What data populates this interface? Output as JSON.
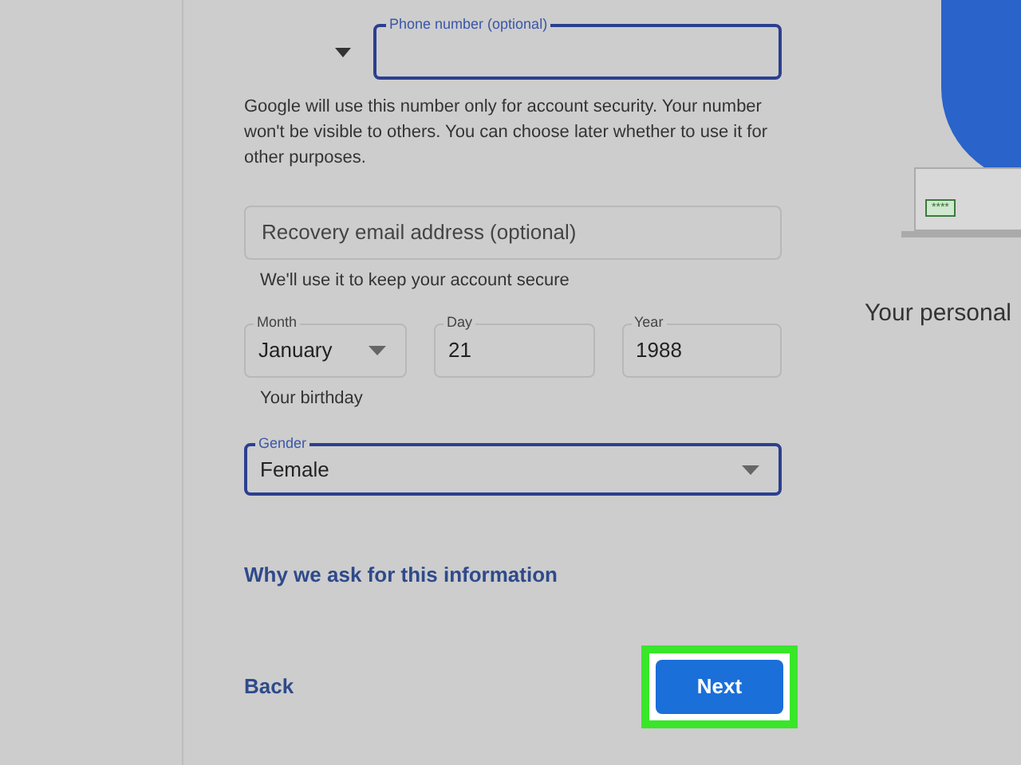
{
  "phone": {
    "label": "Phone number (optional)",
    "focused": true
  },
  "phone_help": "Google will use this number only for account security. Your number won't be visible to others. You can choose later whether to use it for other purposes.",
  "recovery_email": {
    "placeholder": "Recovery email address (optional)",
    "focused": false
  },
  "recovery_help": "We'll use it to keep your account secure",
  "birthday": [
    {
      "label": "Month",
      "value": "January",
      "kind": "dropdown",
      "focused": false
    },
    {
      "label": "Day",
      "value": "21",
      "kind": "text",
      "focused": false
    },
    {
      "label": "Year",
      "value": "1988",
      "kind": "text",
      "focused": false
    }
  ],
  "birthday_help": "Your birthday",
  "gender": {
    "label": "Gender",
    "value": "Female",
    "kind": "dropdown",
    "focused": true
  },
  "info_link": "Why we ask for this information",
  "back_button": "Back",
  "next_button": {
    "label": "Next",
    "highlighted": true
  },
  "side_caption": "Your personal",
  "password_badge": "****"
}
